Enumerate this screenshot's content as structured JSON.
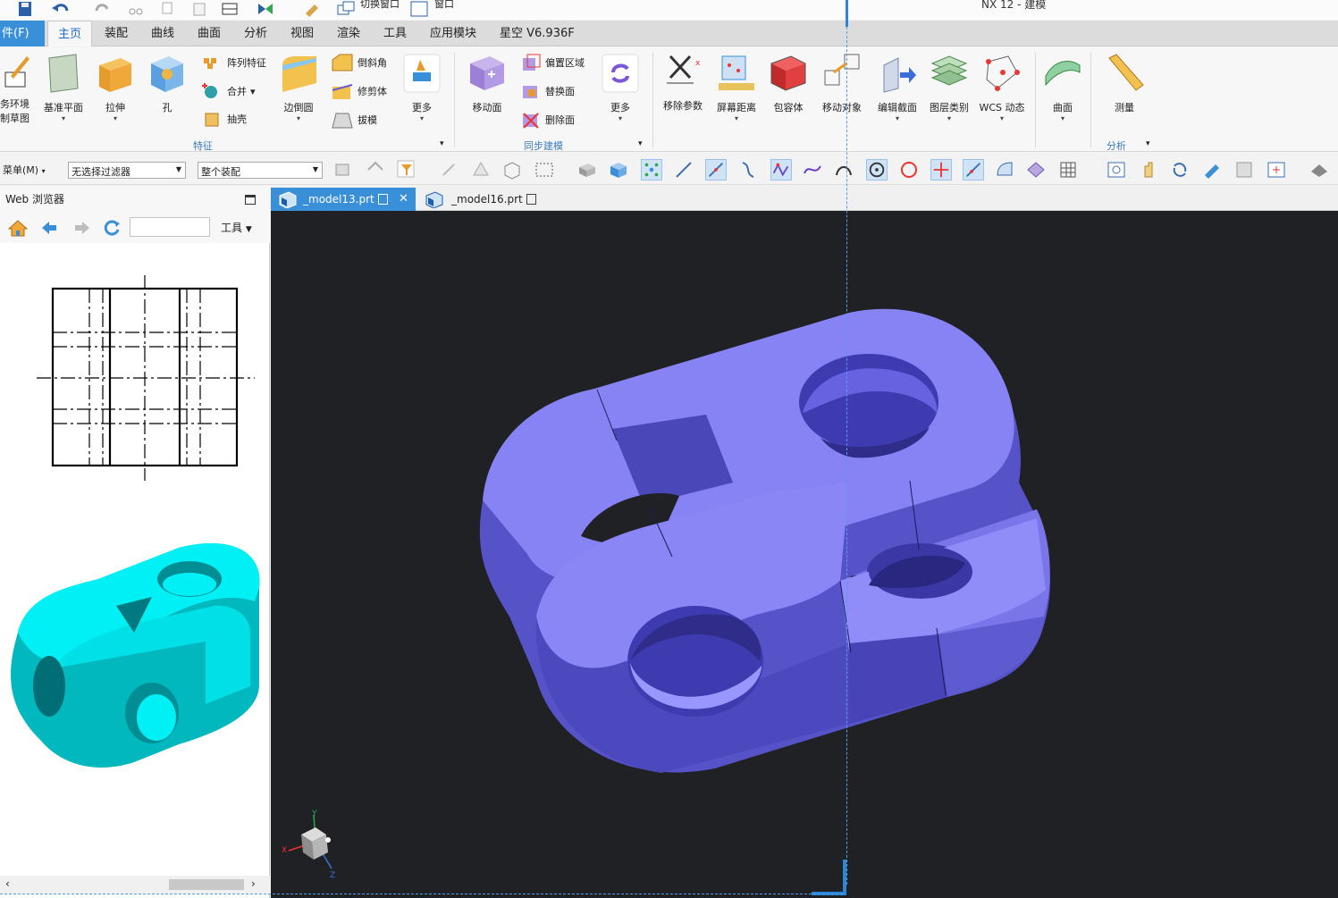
{
  "window": {
    "title": "NX 12 - 建模"
  },
  "quick_access": {
    "switch_window": "切换窗口",
    "window": "窗口"
  },
  "menu_tabs": [
    {
      "label": "件(F)"
    },
    {
      "label": "主页"
    },
    {
      "label": "装配"
    },
    {
      "label": "曲线"
    },
    {
      "label": "曲面"
    },
    {
      "label": "分析"
    },
    {
      "label": "视图"
    },
    {
      "label": "渲染"
    },
    {
      "label": "工具"
    },
    {
      "label": "应用模块"
    },
    {
      "label": "星空 V6.936F"
    }
  ],
  "ribbon": {
    "task_env": {
      "line1": "务环境",
      "line2": "制草图"
    },
    "datum_plane": "基准平面",
    "extrude": "拉伸",
    "hole": "孔",
    "pattern_feature": "阵列特征",
    "unite": "合并",
    "shell": "抽壳",
    "edge_blend": "边倒圆",
    "chamfer": "倒斜角",
    "trim_body": "修剪体",
    "draft": "拔模",
    "more1": "更多",
    "feature_group": "特征",
    "move_face": "移动面",
    "offset_region": "偏置区域",
    "replace_face": "替换面",
    "delete_face": "删除面",
    "more2": "更多",
    "sync_group": "同步建模",
    "remove_params": "移除参数",
    "screen_distance": "屏幕距离",
    "bounding_body": "包容体",
    "move_object": "移动对象",
    "edit_section": "编辑截面",
    "layer_category": "图层类别",
    "wcs_dynamic": "WCS 动态",
    "surface": "曲面",
    "measure": "测量",
    "analysis_group": "分析"
  },
  "toolbar": {
    "menu": "菜单(M)",
    "filter": "无选择过滤器",
    "assembly": "整个装配"
  },
  "left_panel": {
    "title": "Web 浏览器",
    "tools": "工具"
  },
  "doc_tabs": [
    {
      "label": "_model13.prt"
    },
    {
      "label": "_model16.prt"
    }
  ],
  "triad": {
    "x": "X",
    "y": "Y",
    "z": "Z"
  },
  "colors": {
    "accent": "#3a8fd9",
    "model": "#7b76e6",
    "preview": "#00e7ef",
    "viewport_bg": "#202125"
  }
}
